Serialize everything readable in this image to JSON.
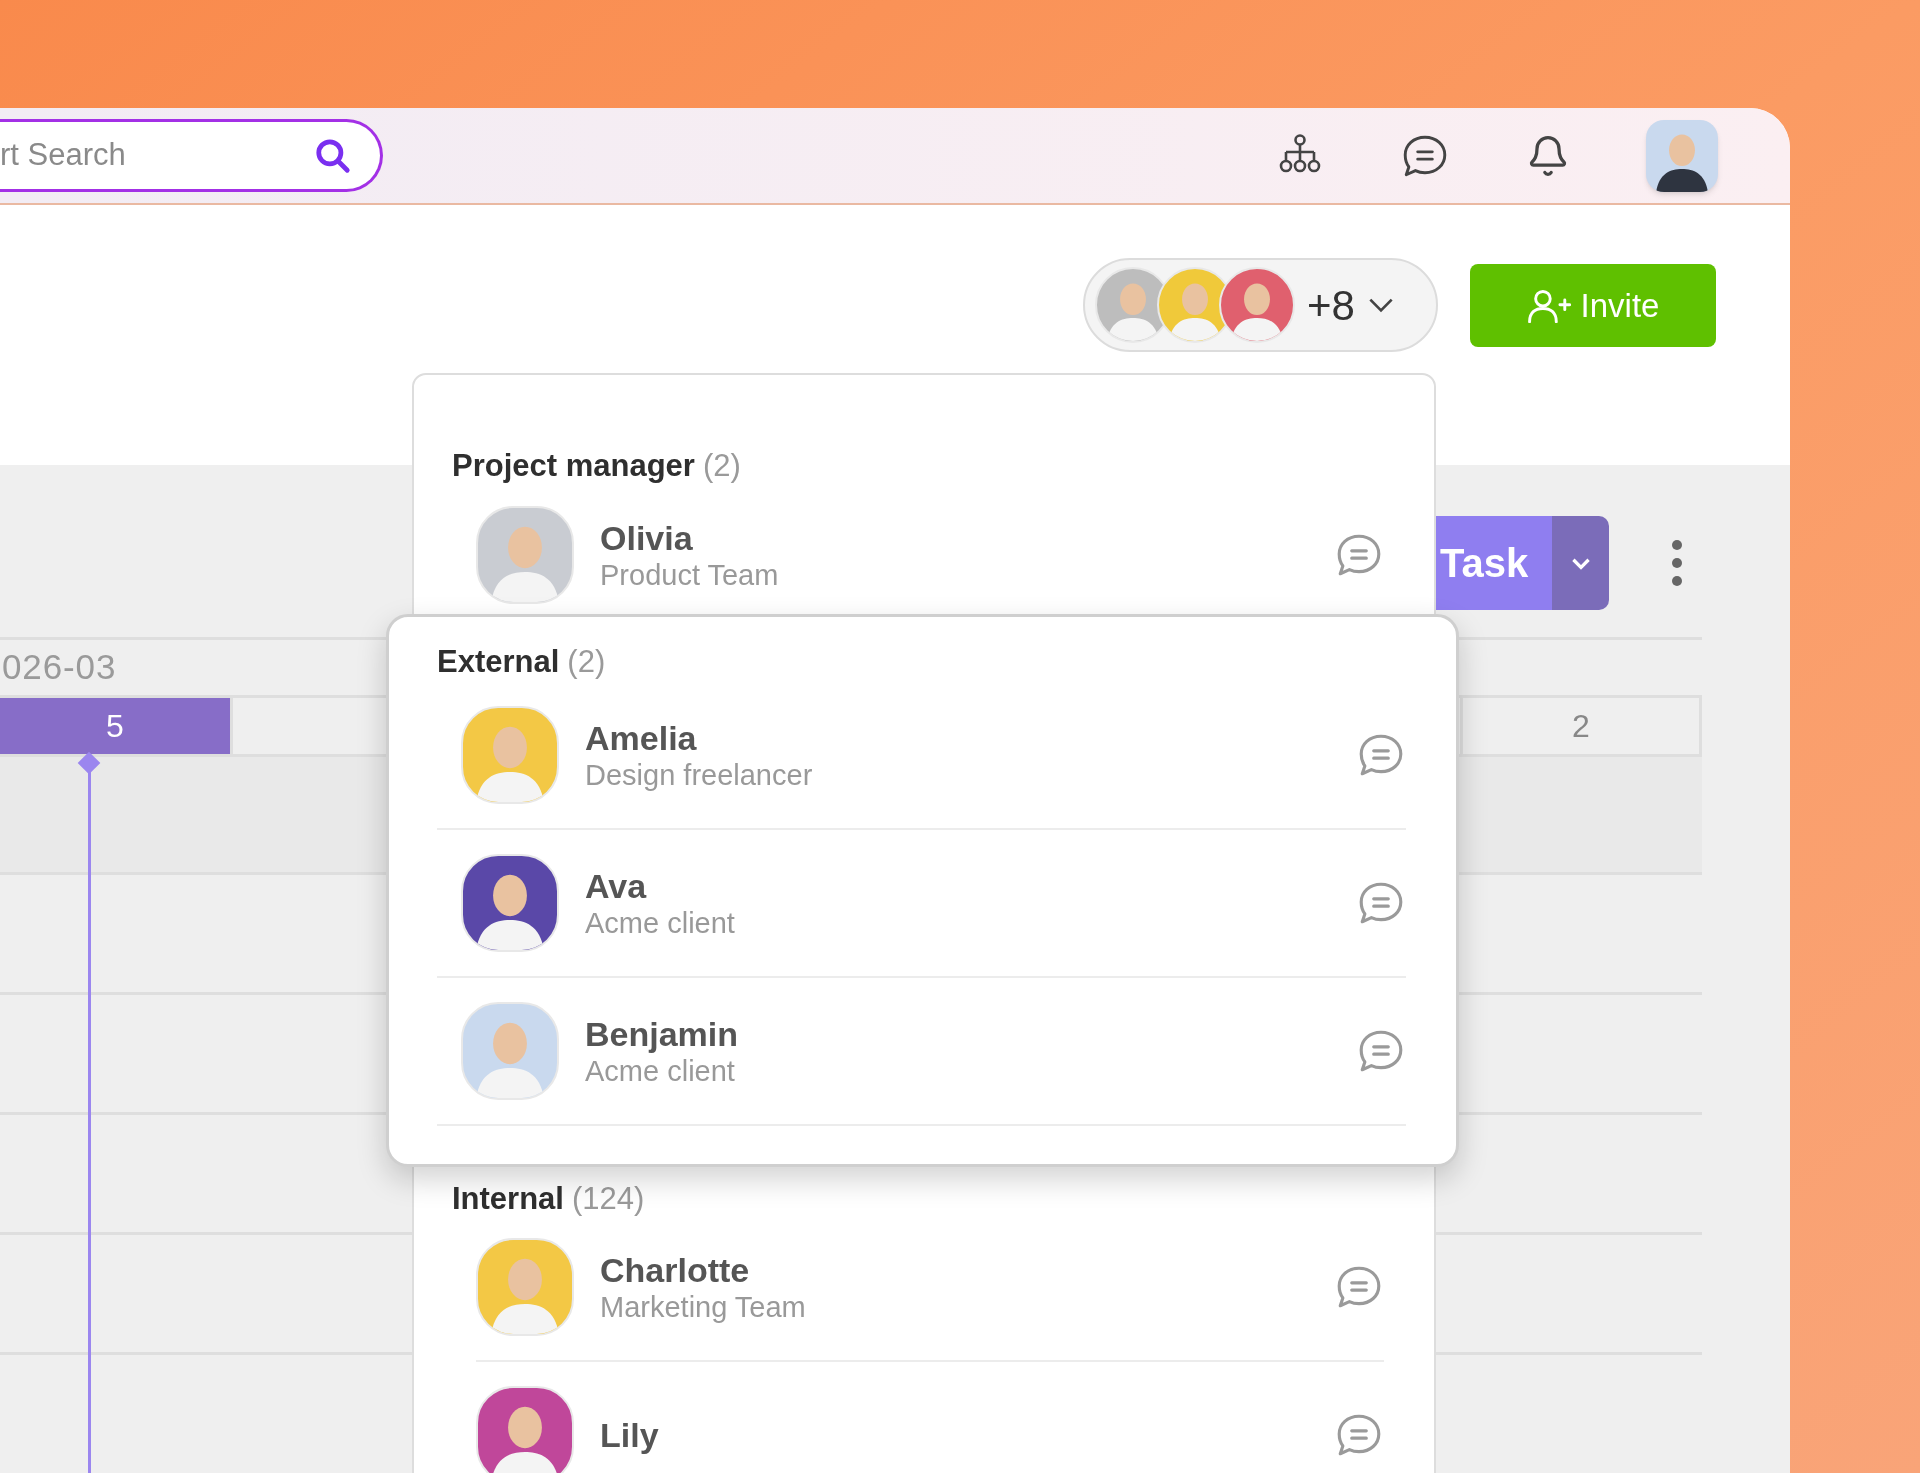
{
  "search": {
    "placeholder": "rt Search"
  },
  "members_summary": {
    "avatars": [
      {
        "color": "#bdbdbd"
      },
      {
        "color": "#f0c93a"
      },
      {
        "color": "#e0606e"
      }
    ],
    "count": "+8"
  },
  "invite_button": {
    "label": "Invite"
  },
  "task_button": {
    "label": "Task"
  },
  "timeline": {
    "month": "026-03",
    "cells": [
      {
        "label": "5",
        "selected": true
      },
      {
        "label": "2",
        "selected": false
      }
    ]
  },
  "groups": [
    {
      "kind": "section",
      "title": "Project manager",
      "count": "(2)",
      "members": [
        {
          "name": "Olivia",
          "role": "Product Team",
          "color": "#c9ccd2"
        }
      ]
    },
    {
      "kind": "popup",
      "title": "External",
      "count": "(2)",
      "members": [
        {
          "name": "Amelia",
          "role": "Design freelancer",
          "color": "#f3c845"
        },
        {
          "name": "Ava",
          "role": "Acme client",
          "color": "#5a48a8"
        },
        {
          "name": "Benjamin",
          "role": "Acme client",
          "color": "#c9d9ee"
        }
      ]
    },
    {
      "kind": "section",
      "title": "Internal",
      "count": "(124)",
      "members": [
        {
          "name": "Charlotte",
          "role": "Marketing Team",
          "color": "#f3c845"
        },
        {
          "name": "Lily",
          "color": "#c0479a"
        }
      ]
    }
  ]
}
